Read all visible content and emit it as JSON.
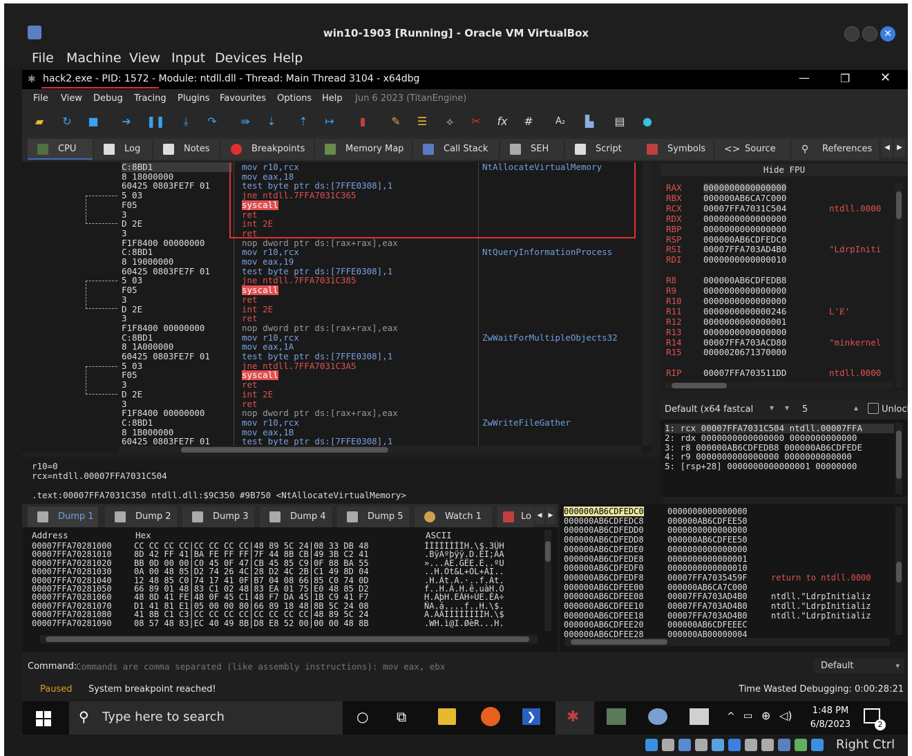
{
  "vbox": {
    "title": "win10-1903 [Running] - Oracle VM VirtualBox",
    "menu": [
      "File",
      "Machine",
      "View",
      "Input",
      "Devices",
      "Help"
    ],
    "host_key": "Right Ctrl"
  },
  "x64dbg": {
    "title": "hack2.exe - PID: 1572 - Module: ntdll.dll - Thread: Main Thread 3104 - x64dbg",
    "menu": [
      "File",
      "View",
      "Debug",
      "Tracing",
      "Plugins",
      "Favourites",
      "Options",
      "Help",
      "Jun 6 2023 (TitanEngine)"
    ],
    "tabs": [
      "CPU",
      "Log",
      "Notes",
      "Breakpoints",
      "Memory Map",
      "Call Stack",
      "SEH",
      "Script",
      "Symbols",
      "Source",
      "References"
    ]
  },
  "disasm": {
    "rows": [
      {
        "b": "C:8BD1",
        "i": "mov r10,rcx",
        "c": "NtAllocateVirtualMemory"
      },
      {
        "b": "8 18000000",
        "i": "mov eax,18",
        "c": ""
      },
      {
        "b": "60425 0803FE7F 01",
        "i": "test byte ptr ds:[7FFE0308],1",
        "c": ""
      },
      {
        "b": "5 03",
        "i": "jne ntdll.7FFA7031C365",
        "c": ""
      },
      {
        "b": "F05",
        "i": "syscall",
        "c": ""
      },
      {
        "b": "3",
        "i": "ret",
        "c": ""
      },
      {
        "b": "D 2E",
        "i": "int 2E",
        "c": ""
      },
      {
        "b": "3",
        "i": "ret",
        "c": ""
      },
      {
        "b": "F1F8400 00000000",
        "i": "nop dword ptr ds:[rax+rax],eax",
        "c": ""
      },
      {
        "b": "C:8BD1",
        "i": "mov r10,rcx",
        "c": "NtQueryInformationProcess"
      },
      {
        "b": "8 19000000",
        "i": "mov eax,19",
        "c": ""
      },
      {
        "b": "60425 0803FE7F 01",
        "i": "test byte ptr ds:[7FFE0308],1",
        "c": ""
      },
      {
        "b": "5 03",
        "i": "jne ntdll.7FFA7031C385",
        "c": ""
      },
      {
        "b": "F05",
        "i": "syscall",
        "c": ""
      },
      {
        "b": "3",
        "i": "ret",
        "c": ""
      },
      {
        "b": "D 2E",
        "i": "int 2E",
        "c": ""
      },
      {
        "b": "3",
        "i": "ret",
        "c": ""
      },
      {
        "b": "F1F8400 00000000",
        "i": "nop dword ptr ds:[rax+rax],eax",
        "c": ""
      },
      {
        "b": "C:8BD1",
        "i": "mov r10,rcx",
        "c": "ZwWaitForMultipleObjects32"
      },
      {
        "b": "8 1A000000",
        "i": "mov eax,1A",
        "c": ""
      },
      {
        "b": "60425 0803FE7F 01",
        "i": "test byte ptr ds:[7FFE0308],1",
        "c": ""
      },
      {
        "b": "5 03",
        "i": "jne ntdll.7FFA7031C3A5",
        "c": ""
      },
      {
        "b": "F05",
        "i": "syscall",
        "c": ""
      },
      {
        "b": "3",
        "i": "ret",
        "c": ""
      },
      {
        "b": "D 2E",
        "i": "int 2E",
        "c": ""
      },
      {
        "b": "3",
        "i": "ret",
        "c": ""
      },
      {
        "b": "F1F8400 00000000",
        "i": "nop dword ptr ds:[rax+rax],eax",
        "c": ""
      },
      {
        "b": "C:8BD1",
        "i": "mov r10,rcx",
        "c": "ZwWriteFileGather"
      },
      {
        "b": "8 1B000000",
        "i": "mov eax,1B",
        "c": ""
      },
      {
        "b": "60425 0803FE7F 01",
        "i": "test byte ptr ds:[7FFE0308],1",
        "c": ""
      }
    ]
  },
  "registers": {
    "header": "Hide FPU",
    "rows": [
      {
        "n": "RAX",
        "v": "0000000000000000",
        "c": ""
      },
      {
        "n": "RBX",
        "v": "000000AB6CA7C000",
        "c": ""
      },
      {
        "n": "RCX",
        "v": "00007FFA7031C504",
        "c": "ntdll.0000"
      },
      {
        "n": "RDX",
        "v": "0000000000000000",
        "c": ""
      },
      {
        "n": "RBP",
        "v": "0000000000000000",
        "c": ""
      },
      {
        "n": "RSP",
        "v": "000000AB6CDFEDC0",
        "c": ""
      },
      {
        "n": "RSI",
        "v": "00007FFA703AD4B0",
        "c": "\"LdrpIniti"
      },
      {
        "n": "RDI",
        "v": "0000000000000010",
        "c": ""
      },
      {
        "n": "",
        "v": "",
        "c": ""
      },
      {
        "n": "R8",
        "v": "000000AB6CDFEDB8",
        "c": ""
      },
      {
        "n": "R9",
        "v": "0000000000000000",
        "c": ""
      },
      {
        "n": "R10",
        "v": "0000000000000000",
        "c": ""
      },
      {
        "n": "R11",
        "v": "0000000000000246",
        "c": "L'Ɇ'"
      },
      {
        "n": "R12",
        "v": "0000000000000001",
        "c": ""
      },
      {
        "n": "R13",
        "v": "0000000000000000",
        "c": ""
      },
      {
        "n": "R14",
        "v": "00007FFA703ACD80",
        "c": "\"minkernel"
      },
      {
        "n": "R15",
        "v": "0000020671370000",
        "c": ""
      },
      {
        "n": "",
        "v": "",
        "c": ""
      },
      {
        "n": "RIP",
        "v": "00007FFA703511DD",
        "c": "ntdll.0000"
      }
    ]
  },
  "callconv": {
    "label": "Default (x64 fastcal",
    "count": "5",
    "unlocked": "Unlocked"
  },
  "stackargs": [
    "1: rcx 00007FFA7031C504 ntdll.00007FFA",
    "2: rdx 0000000000000000 0000000000000",
    "3: r8 000000AB6CDFEDB8 000000AB6CDFEDE",
    "4: r9 0000000000000000 0000000000000",
    "5: [rsp+28] 0000000000000001 00000000"
  ],
  "info": {
    "l1": "r10=0",
    "l2": "rcx=ntdll.00007FFA7031C504",
    "l3": ".text:00007FFA7031C350 ntdll.dll:$9C350 #9B750 <NtAllocateVirtualMemory>"
  },
  "dumptabs": [
    "Dump 1",
    "Dump 2",
    "Dump 3",
    "Dump 4",
    "Dump 5",
    "Watch 1",
    "Lo"
  ],
  "hex": {
    "h_addr": "Address",
    "h_hex": "Hex",
    "h_ascii": "ASCII",
    "rows": [
      {
        "a": "00007FFA70281000",
        "h": "CC CC CC CC|CC CC CC CC|48 89 5C 24|08 33 DB 48",
        "s": "ÌÌÌÌÌÌÌÌH.\\$.3ÛH"
      },
      {
        "a": "00007FFA70281010",
        "h": "8D 42 FF 41|BA FE FF FF|7F 44 8B CB|49 3B C2 41",
        "s": ".BÿAºþÿÿ.D.ËI;ÂA"
      },
      {
        "a": "00007FFA70281020",
        "h": "BB 0D 00 00|C0 45 0F 47|CB 45 85 C9|0F 88 BA 55",
        "s": "»...ÀE.GËE.É..ºU"
      },
      {
        "a": "00007FFA70281030",
        "h": "0A 00 48 85|D2 74 26 4C|28 D2 4C 2B|C1 49 8D 04",
        "s": "..H.Òt&L+ÒL+ÁI.."
      },
      {
        "a": "00007FFA70281040",
        "h": "12 48 85 C0|74 17 41 0F|B7 04 08 66|85 C0 74 0D",
        "s": ".H.Àt.A.·..f.Àt."
      },
      {
        "a": "00007FFA70281050",
        "h": "66 89 01 48|83 C1 02 48|83 EA 01 75|E0 48 85 D2",
        "s": "f..H.Á.H.ê.uàH.Ò"
      },
      {
        "a": "00007FFA70281060",
        "h": "48 8D 41 FE|48 0F 45 C1|48 F7 DA 45|1B C9 41 F7",
        "s": "H.AþH.EÁH÷ÚE.ÉA÷"
      },
      {
        "a": "00007FFA70281070",
        "h": "D1 41 81 E1|05 00 00 80|66 89 18 48|8B 5C 24 08",
        "s": "ÑA.á....f..H.\\$."
      },
      {
        "a": "00007FFA70281080",
        "h": "41 8B C1 C3|CC CC CC CC|CC CC CC CC|48 89 5C 24",
        "s": "A.ÁÃÌÌÌÌÌÌÌÌH.\\$"
      },
      {
        "a": "00007FFA70281090",
        "h": "08 57 48 83|EC 40 49 8B|D8 E8 52 00|00 00 48 8B",
        "s": ".WH.ì@I.ØèR...H."
      }
    ]
  },
  "stack": [
    {
      "a": "000000AB6CDFEDC0",
      "v": "0000000000000000",
      "c": ""
    },
    {
      "a": "000000AB6CDFEDC8",
      "v": "000000AB6CDFEE50",
      "c": ""
    },
    {
      "a": "000000AB6CDFEDD0",
      "v": "0000000000000000",
      "c": ""
    },
    {
      "a": "000000AB6CDFEDD8",
      "v": "000000AB6CDFEE50",
      "c": ""
    },
    {
      "a": "000000AB6CDFEDE0",
      "v": "0000000000000000",
      "c": ""
    },
    {
      "a": "000000AB6CDFEDE8",
      "v": "0000000000000001",
      "c": ""
    },
    {
      "a": "000000AB6CDFEDF0",
      "v": "0000000000000010",
      "c": ""
    },
    {
      "a": "000000AB6CDFEDF8",
      "v": "00007FFA7035459F",
      "c": "return to ntdll.0000"
    },
    {
      "a": "000000AB6CDFEE00",
      "v": "000000AB6CA7C000",
      "c": ""
    },
    {
      "a": "000000AB6CDFEE08",
      "v": "00007FFA703AD4B0",
      "c": "ntdll.\"LdrpInitializ"
    },
    {
      "a": "000000AB6CDFEE10",
      "v": "00007FFA703AD4B0",
      "c": "ntdll.\"LdrpInitializ"
    },
    {
      "a": "000000AB6CDFEE18",
      "v": "00007FFA703AD4B0",
      "c": "ntdll.\"LdrpInitializ"
    },
    {
      "a": "000000AB6CDFEE20",
      "v": "000000AB6CDFEEEC",
      "c": ""
    },
    {
      "a": "000000AB6CDFEE28",
      "v": "000000AB00000004",
      "c": ""
    }
  ],
  "command": {
    "label": "Command:",
    "placeholder": "Commands are comma separated (like assembly instructions): mov eax, ebx",
    "mode": "Default"
  },
  "status": {
    "state": "Paused",
    "msg": "System breakpoint reached!",
    "time": "Time Wasted Debugging: 0:00:28:21"
  },
  "taskbar": {
    "search": "Type here to search",
    "time": "1:48 PM",
    "date": "6/8/2023",
    "notif": "2"
  },
  "colors": {
    "syscall_bg": "#e05050",
    "highlight": "#e0303a",
    "accent": "#3c6fb4"
  }
}
